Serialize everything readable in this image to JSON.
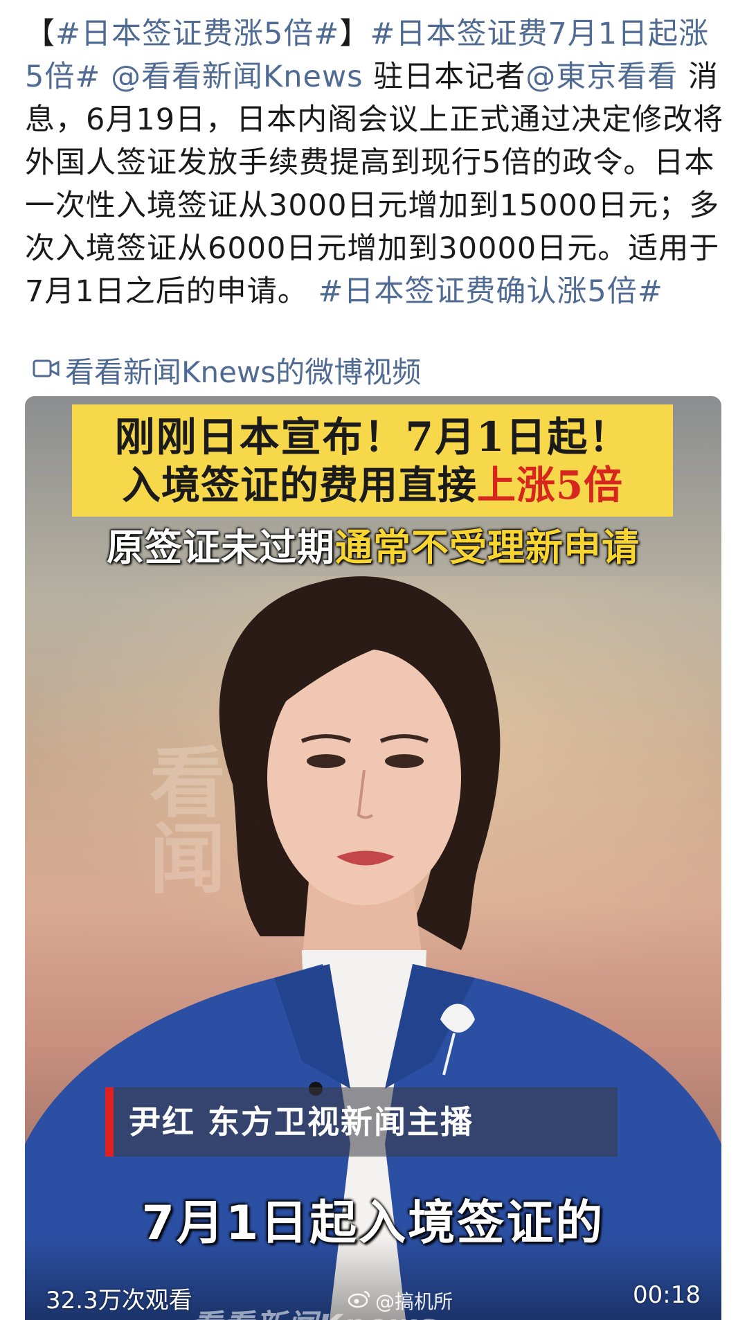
{
  "post": {
    "segments": [
      {
        "text": "【",
        "kind": "text"
      },
      {
        "text": "#日本签证费涨5倍#",
        "kind": "tag"
      },
      {
        "text": "】",
        "kind": "text"
      },
      {
        "text": "#日本签证费7月1日起涨5倍#",
        "kind": "tag"
      },
      {
        "text": " ",
        "kind": "text"
      },
      {
        "text": "@看看新闻Knews",
        "kind": "mention"
      },
      {
        "text": " 驻日本记者",
        "kind": "text"
      },
      {
        "text": "@東京看看",
        "kind": "mention"
      },
      {
        "text": " 消息，6月19日，日本内阁会议上正式通过决定修改将外国人签证发放手续费提高到现行5倍的政令。日本一次性入境签证从3000日元增加到15000日元；多次入境签证从6000日元增加到30000日元。适用于7月1日之后的申请。 ",
        "kind": "text"
      },
      {
        "text": "#日本签证费确认涨5倍#",
        "kind": "tag"
      }
    ],
    "video_link_label": "看看新闻Knews的微博视频"
  },
  "video": {
    "headline_line1": "刚刚日本宣布！7月1日起！",
    "headline_line2_prefix": "入境签证的费用直接",
    "headline_line2_highlight": "上涨5倍",
    "subline_prefix": "原签证未过期",
    "subline_highlight": "通常不受理新申请",
    "name_bar": "尹红  东方卫视新闻主播",
    "caption": "7月1日起入境签证的",
    "views": "32.3万次观看",
    "duration": "00:18",
    "watermark": "@搞机所",
    "logo_strip": "看看新闻Knews",
    "bg_watermark": "看闻"
  },
  "colors": {
    "link": "#4f6a93",
    "headline_bg": "#f6d84a",
    "headline_red": "#d7261e",
    "subline_yellow": "#f8d530",
    "blazer": "#2b4fa2"
  },
  "icons": {
    "video_link": "video-camera-icon",
    "watermark": "weibo-logo-icon"
  }
}
